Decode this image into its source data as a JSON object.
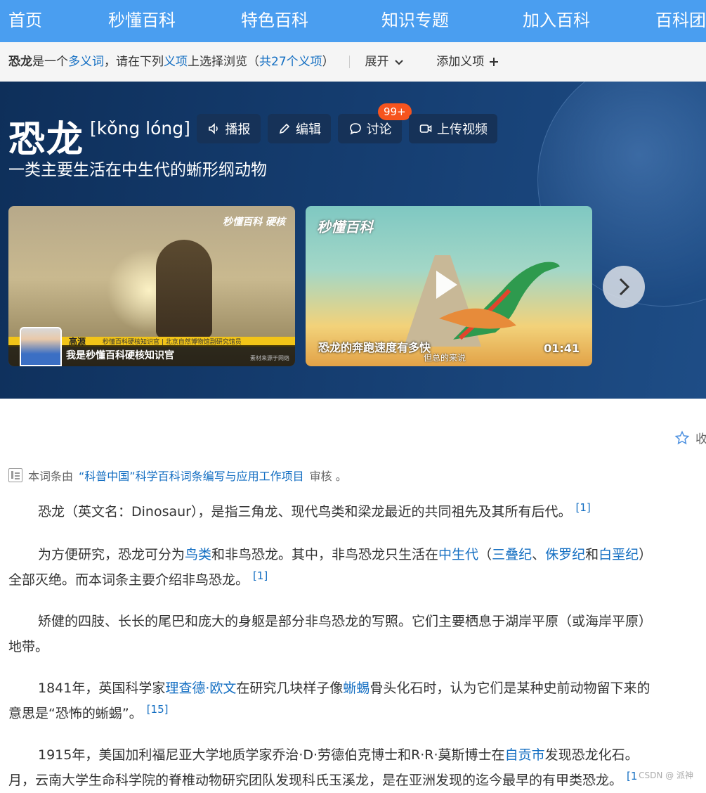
{
  "nav": {
    "items": [
      "首页",
      "秒懂百科",
      "特色百科",
      "知识专题",
      "加入百科",
      "百科团"
    ]
  },
  "polysemy": {
    "term": "恐龙",
    "text1": "是一个",
    "link1": "多义词",
    "text2": "，请在下列",
    "link2": "义项",
    "text3": "上选择浏览（",
    "link3": "共27个义项",
    "text4": "）",
    "expand_label": "展开",
    "add_label": "添加义项"
  },
  "hero": {
    "title": "恐龙",
    "pinyin": "[kǒng lóng]",
    "tools": {
      "broadcast": "播报",
      "edit": "编辑",
      "discuss": "讨论",
      "upload": "上传视频"
    },
    "discuss_badge": "99+",
    "subtitle": "一类主要生活在中生代的蜥形纲动物",
    "video1": {
      "logo": "秒懂百科 硬核",
      "name": "高源",
      "desc": "秒懂百科硬核知识官 | 北京自然博物馆副研究馆员",
      "caption": "我是秒懂百科硬核知识官",
      "note": "素材来源于网络"
    },
    "video2": {
      "logo": "秒懂百科",
      "caption": "恐龙的奔跑速度有多快",
      "duration": "01:41",
      "subtitle_text": "但总的来说"
    }
  },
  "collect_label": "收",
  "review": {
    "prefix": "本词条由",
    "link": "“科普中国”科学百科词条编写与应用工作项目",
    "suffix": "审核 。"
  },
  "paragraphs": {
    "p1": {
      "text": "恐龙（英文名：Dinosaur），是指三角龙、现代鸟类和梁龙最近的共同祖先及其所有后代。",
      "ref": "[1]"
    },
    "p2": {
      "t1": "为方便研究，恐龙可分为",
      "l1": "鸟类",
      "t2": "和非鸟恐龙。其中，非鸟恐龙只生活在",
      "l2": "中生代",
      "t3": "（",
      "l3": "三叠纪",
      "t4": "、",
      "l4": "侏罗纪",
      "t5": "和",
      "l5": "白垩纪",
      "t6": "）",
      "t7": "全部灭绝。而本词条主要介绍非鸟恐龙。",
      "ref": "[1]"
    },
    "p3": {
      "text1": "矫健的四肢、长长的尾巴和庞大的身躯是部分非鸟恐龙的写照。它们主要栖息于湖岸平原（或海岸平原）",
      "text2": "地带。"
    },
    "p4": {
      "t1": "1841年，英国科学家",
      "l1": "理查德·欧文",
      "t2": "在研究几块样子像",
      "l2": "蜥蜴",
      "t3": "骨头化石时，认为它们是某种史前动物留下来的",
      "t4": "意思是“恐怖的蜥蜴”。",
      "ref": "[15]"
    },
    "p5": {
      "t1": "1915年，美国加利福尼亚大学地质学家乔治·D·劳德伯克博士和R·R·莫斯博士在",
      "l1": "自贡市",
      "t2": "发现恐龙化石。",
      "t3": "月，云南大学生命科学院的脊椎动物研究团队发现科氏玉溪龙，是在亚洲发现的迄今最早的有甲类恐龙。",
      "ref": "[1"
    }
  },
  "watermark": "CSDN @ 派神"
}
